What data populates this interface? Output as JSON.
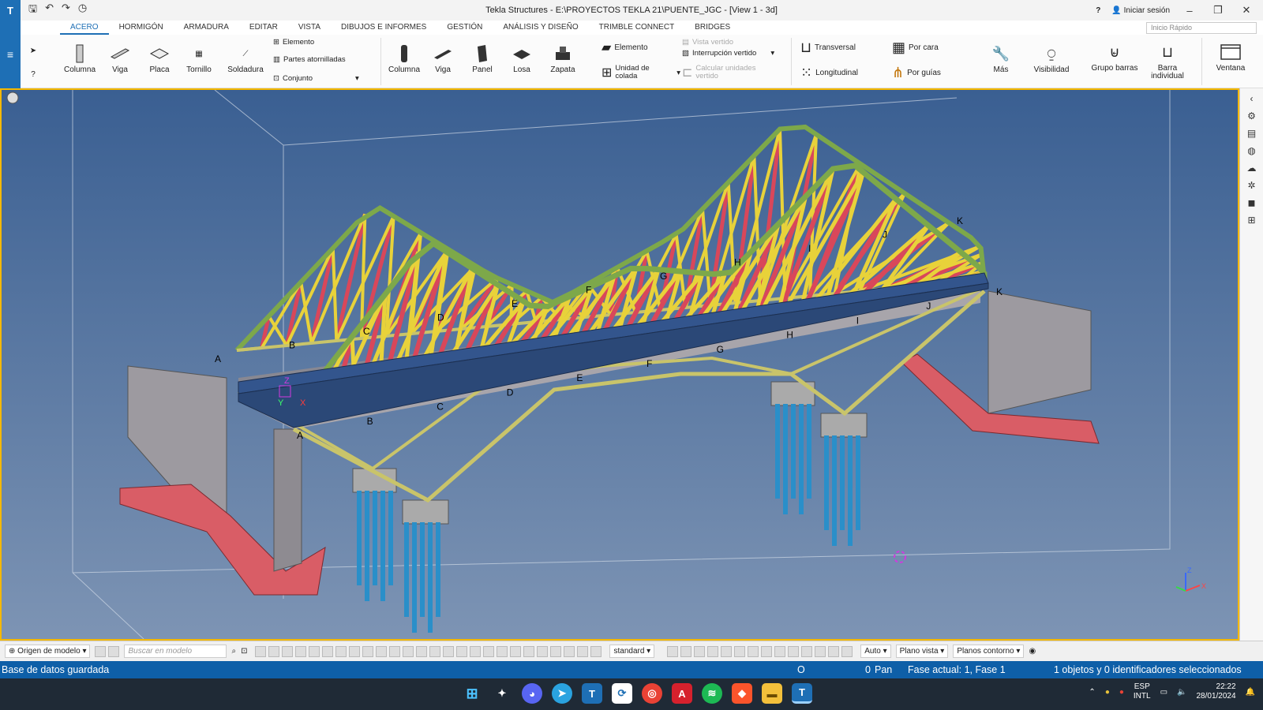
{
  "title": "Tekla Structures - E:\\PROYECTOS TEKLA 21\\PUENTE_JGC - [View 1 - 3d]",
  "titlebar": {
    "help": "?",
    "signin": "Iniciar sesión",
    "minimize": "–",
    "restore": "❐",
    "close": "✕"
  },
  "menu": [
    "ACERO",
    "HORMIGÓN",
    "ARMADURA",
    "EDITAR",
    "VISTA",
    "DIBUJOS E INFORMES",
    "GESTIÓN",
    "ANÁLISIS Y DISEÑO",
    "TRIMBLE CONNECT",
    "BRIDGES"
  ],
  "quick_search": "Inicio Rápido",
  "ribbon": {
    "acero": {
      "columna": "Columna",
      "viga": "Viga",
      "placa": "Placa",
      "tornillo": "Tornillo",
      "soldadura": "Soldadura",
      "elemento": "Elemento",
      "partes_atornilladas": "Partes atornilladas",
      "conjunto": "Conjunto"
    },
    "hormigon": {
      "columna": "Columna",
      "viga": "Viga",
      "panel": "Panel",
      "losa": "Losa",
      "zapata": "Zapata",
      "elemento": "Elemento",
      "unidad_colada": "Unidad de colada",
      "vista_vertido": "Vista vertido",
      "interrupcion_vertido": "Interrupción vertido",
      "calcular_unidades": "Calcular unidades vertido"
    },
    "armadura": {
      "transversal": "Transversal",
      "longitudinal": "Longitudinal",
      "por_cara": "Por cara",
      "por_guias": "Por guías"
    },
    "otros": {
      "mas": "Más",
      "visibilidad": "Visibilidad",
      "grupo_barras": "Grupo barras",
      "barra_individual": "Barra individual",
      "ventana": "Ventana"
    }
  },
  "viewport": {
    "grid_labels_front": [
      "A",
      "B",
      "C",
      "D",
      "E",
      "F",
      "G",
      "H",
      "I",
      "J",
      "K"
    ],
    "grid_labels_back": [
      "A",
      "B",
      "C",
      "D",
      "E",
      "F",
      "G",
      "H",
      "I",
      "J",
      "K"
    ],
    "axis": {
      "x": "X",
      "y": "Y",
      "z": "Z"
    }
  },
  "bottom_toolbar": {
    "origin": "Origen de modelo",
    "search_placeholder": "Buscar en modelo",
    "standard": "standard",
    "auto": "Auto",
    "plano_vista": "Plano vista",
    "planos_contorno": "Planos contorno"
  },
  "status": {
    "left": "Base de datos guardada",
    "o": "O",
    "zero": "0",
    "pan": "Pan",
    "fase": "Fase actual: 1, Fase 1",
    "seleccion": "1 objetos y 0 identificadores seleccionados"
  },
  "taskbar": {
    "lang1": "ESP",
    "lang2": "INTL",
    "time": "22:22",
    "date": "28/01/2024"
  }
}
